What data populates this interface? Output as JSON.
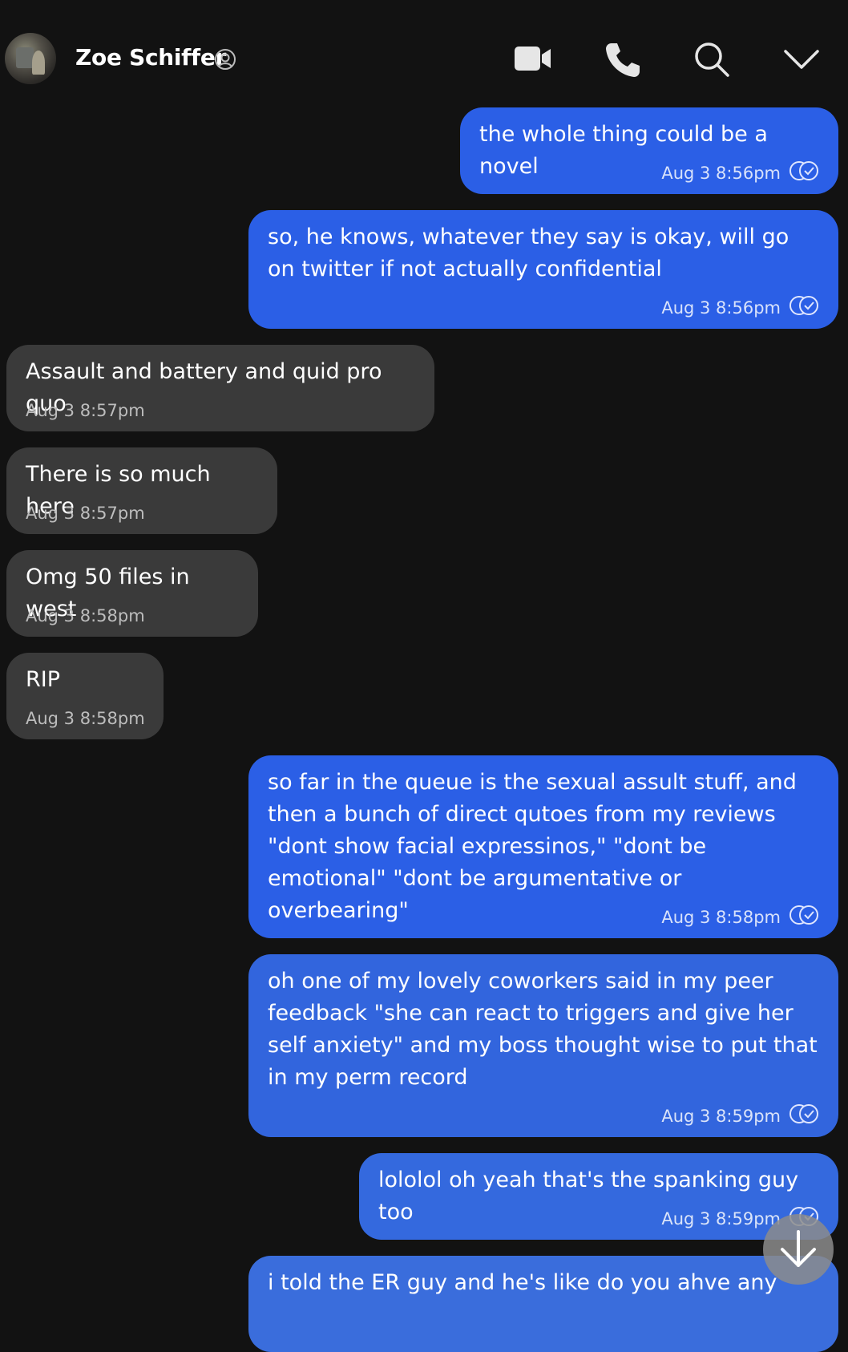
{
  "header": {
    "contact_name": "Zoe Schiffer",
    "icons": [
      "video-camera-icon",
      "phone-icon",
      "search-icon",
      "chevron-down-icon"
    ]
  },
  "colors": {
    "background": "#121212",
    "outgoing_bubble": "#2b5fe6",
    "incoming_bubble": "#3a3a3a"
  },
  "messages": [
    {
      "direction": "outgoing",
      "text": "the whole thing could be a novel",
      "time": "Aug 3 8:56pm",
      "read": true
    },
    {
      "direction": "outgoing",
      "text": "so, he knows, whatever they say is okay, will go on twitter if not actually confidential",
      "time": "Aug 3 8:56pm",
      "read": true
    },
    {
      "direction": "incoming",
      "text": "Assault and battery and quid pro quo",
      "time": "Aug 3 8:57pm"
    },
    {
      "direction": "incoming",
      "text": "There is so much here",
      "time": "Aug 3 8:57pm"
    },
    {
      "direction": "incoming",
      "text": "Omg 50 files in west",
      "time": "Aug 3 8:58pm"
    },
    {
      "direction": "incoming",
      "text": "RIP",
      "time": "Aug 3 8:58pm"
    },
    {
      "direction": "outgoing",
      "text": "so far in the queue is the sexual assult stuff, and then a bunch of direct qutoes from my reviews \"dont show facial expressinos,\" \"dont be emotional\" \"dont be argumentative or overbearing\"",
      "time": "Aug 3 8:58pm",
      "read": true
    },
    {
      "direction": "outgoing",
      "text": "oh one of my lovely coworkers said in my peer feedback \"she can react to triggers and give her self anxiety\" and my boss thought wise to put that in my perm record",
      "time": "Aug 3 8:59pm",
      "read": true
    },
    {
      "direction": "outgoing",
      "text": "lololol oh yeah that's the spanking guy too",
      "time": "Aug 3 8:59pm",
      "read": true
    },
    {
      "direction": "outgoing",
      "text": "i told the ER guy and he's like do you ahve any",
      "time": "",
      "read": false
    }
  ],
  "scroll_button": {
    "icon": "arrow-down-icon"
  }
}
